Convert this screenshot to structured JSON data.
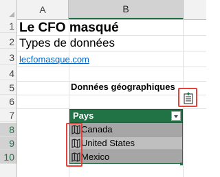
{
  "columns": [
    "A",
    "B"
  ],
  "rows": [
    "1",
    "2",
    "3",
    "4",
    "5",
    "6",
    "7",
    "8",
    "9",
    "10"
  ],
  "cells": {
    "title": "Le CFO masqué",
    "subtitle": "Types de données",
    "link": "lecfomasque.com",
    "geo_label": "Données géographiques"
  },
  "table": {
    "header": "Pays",
    "items": [
      "Canada",
      "United States",
      "Mexico"
    ]
  },
  "icons": {
    "insert_data": "insert-data-icon",
    "map": "map-icon",
    "filter": "chevron-down-icon"
  },
  "colors": {
    "table_header": "#217346",
    "highlight": "#e8413c",
    "link": "#0563c1"
  }
}
